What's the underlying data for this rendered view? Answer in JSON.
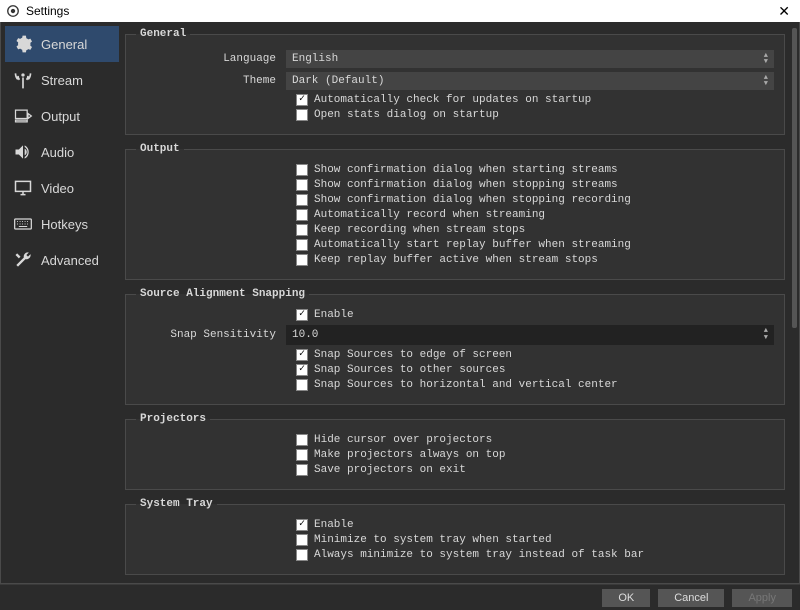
{
  "window": {
    "title": "Settings"
  },
  "sidebar": {
    "items": [
      {
        "label": "General"
      },
      {
        "label": "Stream"
      },
      {
        "label": "Output"
      },
      {
        "label": "Audio"
      },
      {
        "label": "Video"
      },
      {
        "label": "Hotkeys"
      },
      {
        "label": "Advanced"
      }
    ]
  },
  "sections": {
    "general": {
      "title": "General",
      "language_label": "Language",
      "language_value": "English",
      "theme_label": "Theme",
      "theme_value": "Dark (Default)",
      "auto_update": "Automatically check for updates on startup",
      "open_stats": "Open stats dialog on startup"
    },
    "output": {
      "title": "Output",
      "confirm_start": "Show confirmation dialog when starting streams",
      "confirm_stop": "Show confirmation dialog when stopping streams",
      "confirm_stop_rec": "Show confirmation dialog when stopping recording",
      "auto_record": "Automatically record when streaming",
      "keep_recording": "Keep recording when stream stops",
      "auto_replay": "Automatically start replay buffer when streaming",
      "keep_replay": "Keep replay buffer active when stream stops"
    },
    "snapping": {
      "title": "Source Alignment Snapping",
      "enable": "Enable",
      "sensitivity_label": "Snap Sensitivity",
      "sensitivity_value": "10.0",
      "edge": "Snap Sources to edge of screen",
      "other": "Snap Sources to other sources",
      "center": "Snap Sources to horizontal and vertical center"
    },
    "projectors": {
      "title": "Projectors",
      "hide_cursor": "Hide cursor over projectors",
      "always_top": "Make projectors always on top",
      "save_exit": "Save projectors on exit"
    },
    "tray": {
      "title": "System Tray",
      "enable": "Enable",
      "minimize_start": "Minimize to system tray when started",
      "always_minimize": "Always minimize to system tray instead of task bar"
    }
  },
  "footer": {
    "ok": "OK",
    "cancel": "Cancel",
    "apply": "Apply"
  }
}
